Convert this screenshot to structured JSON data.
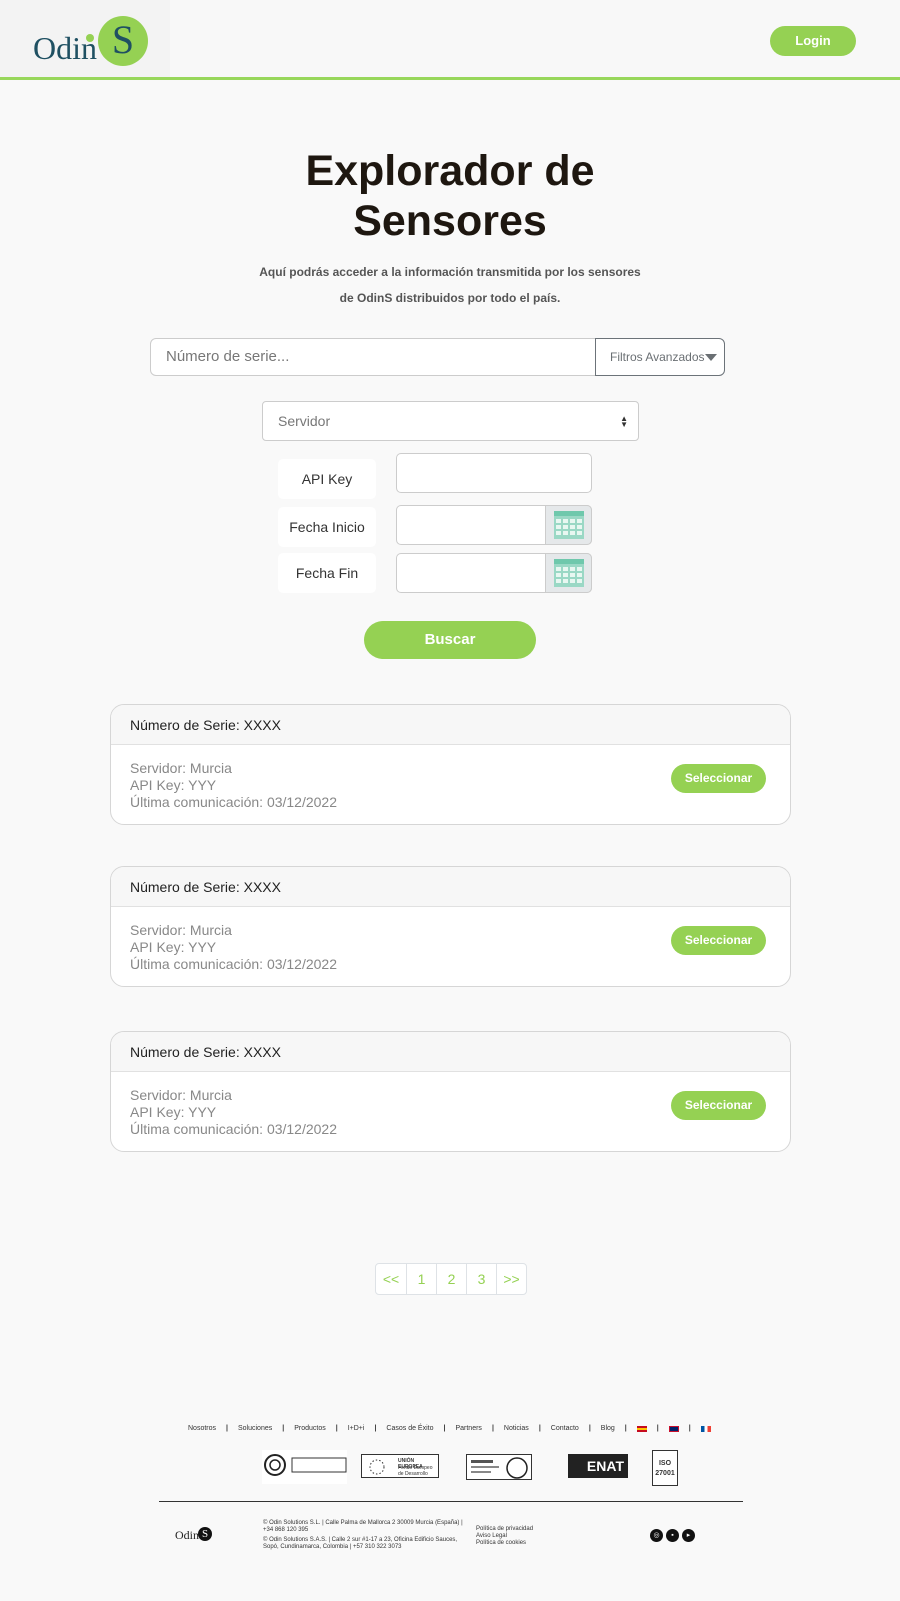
{
  "header": {
    "logo_text": "Odin",
    "logo_letter": "S",
    "login_label": "Login"
  },
  "main": {
    "title_line1": "Explorador de",
    "title_line2": "Sensores",
    "subtitle_line1": "Aquí podrás acceder a la información transmitida por los sensores",
    "subtitle_line2": "de OdinS distribuidos por todo el país.",
    "search_placeholder": "Número de serie...",
    "filters_label": "Filtros Avanzados",
    "server_placeholder": "Servidor",
    "api_key_label": "API Key",
    "start_date_label": "Fecha Inicio",
    "end_date_label": "Fecha Fin",
    "search_button": "Buscar"
  },
  "results": [
    {
      "header": "Número de Serie: XXXX",
      "server": "Servidor: Murcia",
      "api_key": "API Key: YYY",
      "last_comm": "Última comunicación: 03/12/2022",
      "select_label": "Seleccionar"
    },
    {
      "header": "Número de Serie: XXXX",
      "server": "Servidor: Murcia",
      "api_key": "API Key: YYY",
      "last_comm": "Última comunicación: 03/12/2022",
      "select_label": "Seleccionar"
    },
    {
      "header": "Número de Serie: XXXX",
      "server": "Servidor: Murcia",
      "api_key": "API Key: YYY",
      "last_comm": "Última comunicación: 03/12/2022",
      "select_label": "Seleccionar"
    }
  ],
  "pagination": [
    "<<",
    "1",
    "2",
    "3",
    ">>"
  ],
  "footer": {
    "links": [
      "Nosotros",
      "Soluciones",
      "Productos",
      "I+D+i",
      "Casos de Éxito",
      "Partners",
      "Noticias",
      "Contacto",
      "Blog"
    ],
    "logo_text": "Odin",
    "logo_letter": "S",
    "address_1": "© Odin Solutions S.L. | Calle Palma de Mallorca 2 30009 Murcia (España) | +34 868 120 395",
    "address_2": "© Odin Solutions S.A.S. | Calle 2 sur #1-17 a 23, Oficina Edificio Sauces, Sopó, Cundinamarca, Colombia | +57 310 322 3073",
    "legal_1": "Política de privacidad",
    "legal_2": "Aviso Legal",
    "legal_3": "Política de cookies",
    "logo_union_europea": "UNIÓN EUROPEA",
    "logo_union_sub": "Fondo Europeo de Desarrollo Regional",
    "logo_iso": "ISO 27001",
    "logo_enat": "ENAT"
  },
  "colors": {
    "accent": "#95d153",
    "brand_dark": "#1f5062"
  },
  "icons": {
    "calendar": "calendar-icon",
    "caret": "caret-down-icon"
  }
}
